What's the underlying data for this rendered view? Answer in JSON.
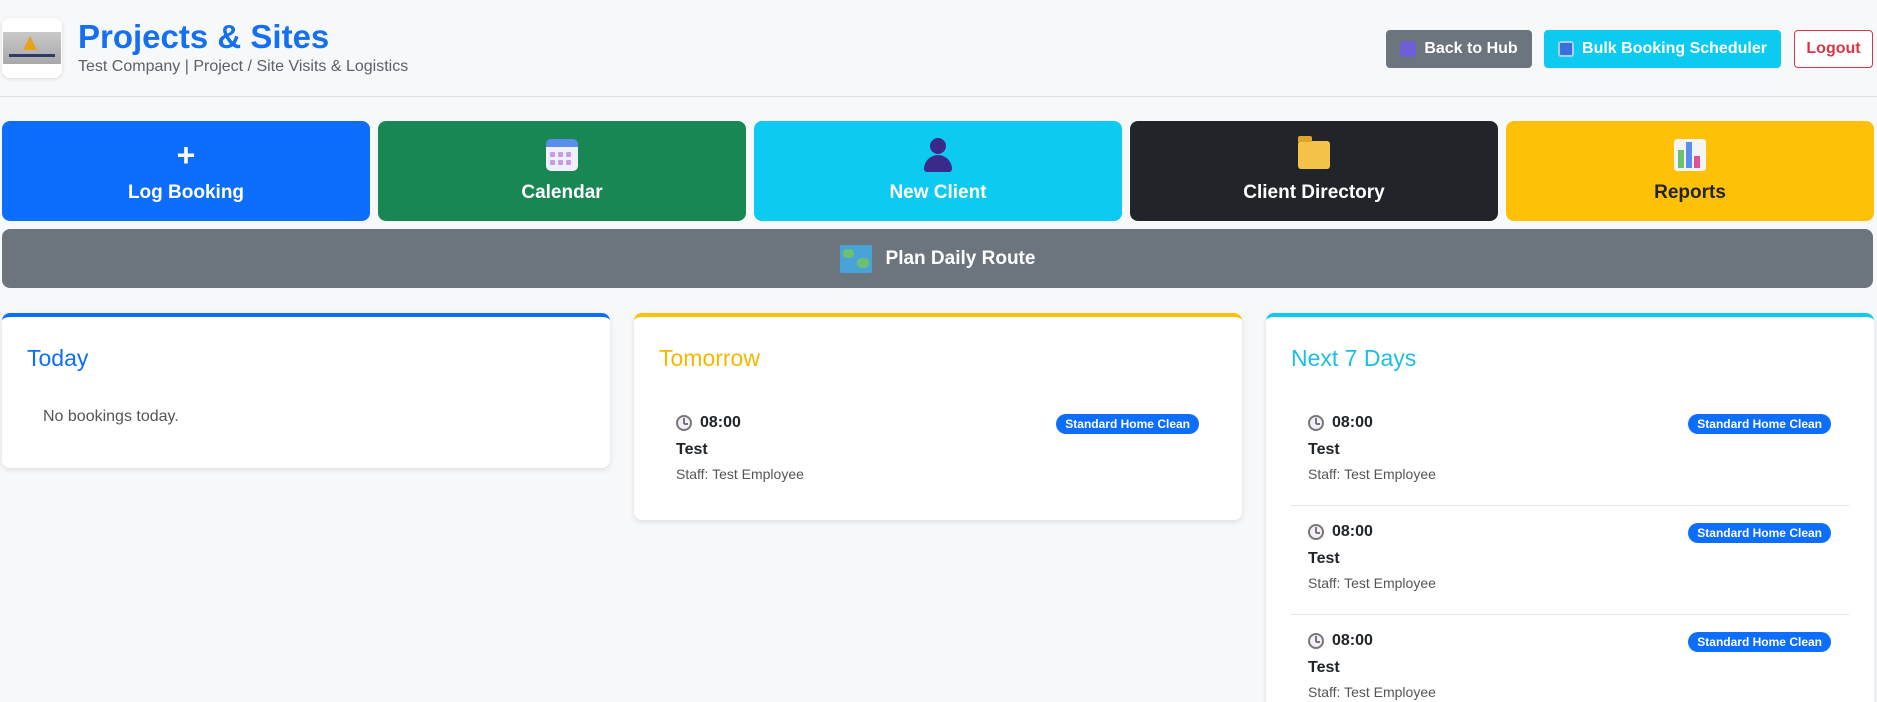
{
  "header": {
    "title": "Projects & Sites",
    "subtitle": "Test Company | Project / Site Visits & Logistics",
    "back_label": "Back to Hub",
    "bulk_label": "Bulk Booking Scheduler",
    "logout_label": "Logout"
  },
  "tiles": [
    {
      "label": "Log Booking",
      "icon": "plus-icon"
    },
    {
      "label": "Calendar",
      "icon": "calendar-icon"
    },
    {
      "label": "New Client",
      "icon": "person-icon"
    },
    {
      "label": "Client Directory",
      "icon": "folder-icon"
    },
    {
      "label": "Reports",
      "icon": "bar-chart-icon"
    }
  ],
  "route": {
    "label": "Plan Daily Route",
    "icon": "map-icon"
  },
  "today": {
    "title": "Today",
    "empty": "No bookings today."
  },
  "tomorrow": {
    "title": "Tomorrow",
    "bookings": [
      {
        "time": "08:00",
        "badge": "Standard Home Clean",
        "name": "Test",
        "staff": "Staff: Test Employee"
      }
    ]
  },
  "next7": {
    "title": "Next 7 Days",
    "bookings": [
      {
        "time": "08:00",
        "badge": "Standard Home Clean",
        "name": "Test",
        "staff": "Staff: Test Employee"
      },
      {
        "time": "08:00",
        "badge": "Standard Home Clean",
        "name": "Test",
        "staff": "Staff: Test Employee"
      },
      {
        "time": "08:00",
        "badge": "Standard Home Clean",
        "name": "Test",
        "staff": "Staff: Test Employee"
      }
    ]
  },
  "colors": {
    "primary": "#0d6efd",
    "success": "#198754",
    "info": "#0dcaf0",
    "dark": "#212529",
    "warning": "#ffc107",
    "secondary": "#6c757d",
    "danger": "#dc3545"
  }
}
